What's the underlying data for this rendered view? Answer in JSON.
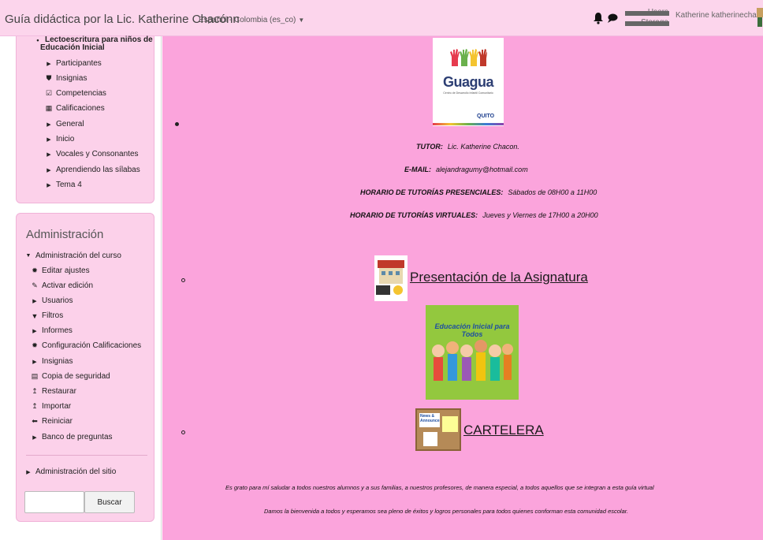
{
  "header": {
    "site_title": "Guía didáctica por la Lic. Katherine Chacónn",
    "language": "Español - Colombia (es_co)",
    "usage_users_label": "Users",
    "usage_storage_label": "Storage",
    "user_name": "Katherine katherinechacon"
  },
  "sidebar": {
    "course_block": {
      "items": [
        {
          "label": "Lectoescritura para niños de",
          "icon": "bullet"
        },
        {
          "label": "Educación Inicial",
          "icon": "none"
        },
        {
          "label": "Participantes",
          "icon": "caret-right-icon"
        },
        {
          "label": "Insignias",
          "icon": "shield-icon"
        },
        {
          "label": "Competencias",
          "icon": "checkbox-icon"
        },
        {
          "label": "Calificaciones",
          "icon": "table-icon"
        },
        {
          "label": "General",
          "icon": "caret-right-icon"
        },
        {
          "label": "Inicio",
          "icon": "caret-right-icon"
        },
        {
          "label": "Vocales y Consonantes",
          "icon": "caret-right-icon"
        },
        {
          "label": "Aprendiendo las sílabas",
          "icon": "caret-right-icon"
        },
        {
          "label": "Tema 4",
          "icon": "caret-right-icon"
        }
      ]
    },
    "admin_block": {
      "title": "Administración",
      "items": [
        {
          "label": "Administración del curso",
          "icon": "caret-down-icon"
        },
        {
          "label": "Editar ajustes",
          "icon": "gear-icon"
        },
        {
          "label": "Activar edición",
          "icon": "pencil-icon"
        },
        {
          "label": "Usuarios",
          "icon": "caret-right-icon"
        },
        {
          "label": "Filtros",
          "icon": "filter-icon"
        },
        {
          "label": "Informes",
          "icon": "caret-right-icon"
        },
        {
          "label": "Configuración Calificaciones",
          "icon": "gear-icon"
        },
        {
          "label": "Insignias",
          "icon": "caret-right-icon"
        },
        {
          "label": "Copia de seguridad",
          "icon": "file-icon"
        },
        {
          "label": "Restaurar",
          "icon": "upload-icon"
        },
        {
          "label": "Importar",
          "icon": "upload-icon"
        },
        {
          "label": "Reiniciar",
          "icon": "arrow-left-icon"
        },
        {
          "label": "Banco de preguntas",
          "icon": "caret-right-icon"
        }
      ],
      "site_admin_label": "Administración del sitio",
      "search_button": "Buscar",
      "search_value": ""
    }
  },
  "main": {
    "logo": {
      "word": "Guagua",
      "subtitle": "Centro de Desarrollo Infantil Comunitario",
      "partner": "QUITO"
    },
    "tutor_label": "TUTOR:",
    "tutor_value": "Lic. Katherine Chacon.",
    "email_label": "E-MAIL:",
    "email_value": "alejandragumy@hotmail.com",
    "presencial_label": "HORARIO DE TUTORÍAS PRESENCIALES:",
    "presencial_value": "Sábados de 08H00 a 11H00",
    "virtual_label": "HORARIO DE TUTORÍAS VIRTUALES:",
    "virtual_value": "Jueves y Viernes  de 17H00 a 20H00",
    "presentation_link": "Presentación de la Asignatura",
    "education_image_text": "Educación Inicial para Todos",
    "cartelera_link": "CARTELERA",
    "cartelera_note": "News & Announcements",
    "paragraph1": "Es grato para mí saludar a todos nuestros alumnos y a sus familias, a nuestros profesores, de manera especial, a todos aquellos que se integran a esta guía  virtual",
    "paragraph2": "Damos la bienvenida a todos y  esperamos sea pleno de éxitos y logros personales para todos quienes conforman esta comunidad escolar."
  },
  "colors": {
    "navbar_bg": "#fcd5ec",
    "sidebar_bg": "#fcd1ea",
    "main_bg": "#fba4dc"
  }
}
